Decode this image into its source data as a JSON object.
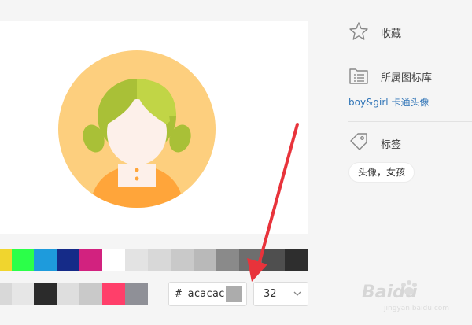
{
  "palette": {
    "row1": [
      "#f0d52e",
      "#2bff49",
      "#1e9bdc",
      "#152b88",
      "#d2227f",
      "#ffffff",
      "#e3e3e3",
      "#d8d8d8",
      "#c9c9c9",
      "#b9b9b9",
      "#8a8a8a",
      "#6e6e6e",
      "#4f4f4f",
      "#2e2e2e"
    ],
    "row2": [
      "#d8d8d8",
      "#e6e6e6",
      "#2b2b2b",
      "#dedede",
      "#c9c9c9",
      "#ff3f6a",
      "#8f9097"
    ]
  },
  "color_picker": {
    "hex_value": "# acacac",
    "current_color": "#acacac"
  },
  "size_select": {
    "value": "32"
  },
  "sidebar": {
    "favorite_label": "收藏",
    "library_label": "所属图标库",
    "library_link": "boy&girl 卡通头像",
    "tags_label": "标签",
    "tag_value": "头像，女孩"
  },
  "watermark": {
    "brand": "Baidu",
    "sub": "jingyan.baidu.com"
  }
}
